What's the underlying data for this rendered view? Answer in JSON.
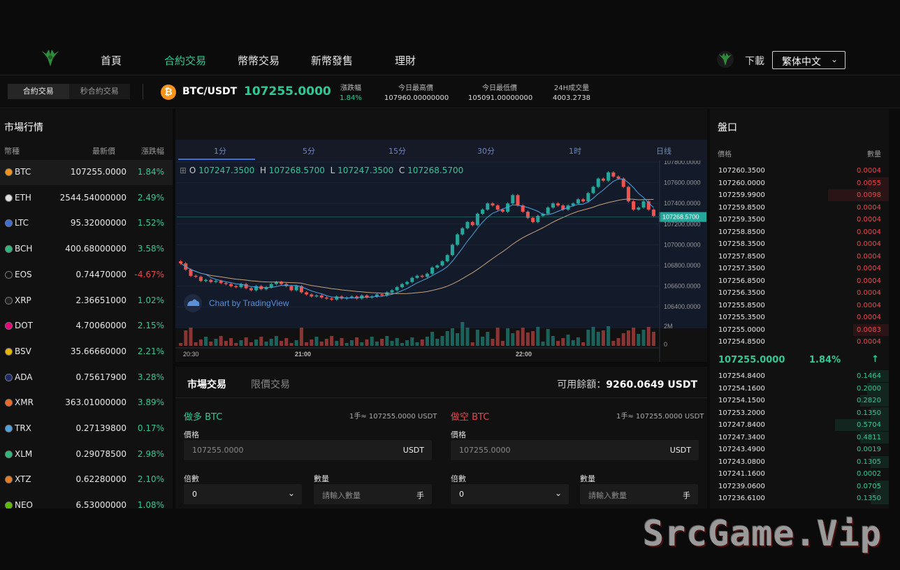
{
  "nav": {
    "items": [
      "首頁",
      "合約交易",
      "幣幣交易",
      "新幣發售",
      "理財"
    ],
    "active_index": 1,
    "download": "下載",
    "language": "繁体中文"
  },
  "ticker": {
    "modes": [
      "合約交易",
      "秒合約交易"
    ],
    "pair": "BTC/USDT",
    "price": "107255.0000",
    "stats": [
      {
        "k": "漲跌幅",
        "v": "1.84%"
      },
      {
        "k": "今日最高價",
        "v": "107960.00000000"
      },
      {
        "k": "今日最低價",
        "v": "105091.00000000"
      },
      {
        "k": "24H成交量",
        "v": "4003.2738"
      }
    ]
  },
  "market": {
    "title": "市場行情",
    "headers": [
      "幣種",
      "最新價",
      "漲跌幅"
    ],
    "rows": [
      {
        "sym": "BTC",
        "last": "107255.0000",
        "pct": "1.84%",
        "color": "#f7931a"
      },
      {
        "sym": "ETH",
        "last": "2544.54000000",
        "pct": "2.49%",
        "color": "#e0e0e0"
      },
      {
        "sym": "LTC",
        "last": "95.32000000",
        "pct": "1.52%",
        "color": "#3b6fd4"
      },
      {
        "sym": "BCH",
        "last": "400.68000000",
        "pct": "3.58%",
        "color": "#2fb67a"
      },
      {
        "sym": "EOS",
        "last": "0.74470000",
        "pct": "-4.67%",
        "color": "#111111"
      },
      {
        "sym": "XRP",
        "last": "2.36651000",
        "pct": "1.02%",
        "color": "#222222"
      },
      {
        "sym": "DOT",
        "last": "4.70060000",
        "pct": "2.15%",
        "color": "#e6007a"
      },
      {
        "sym": "BSV",
        "last": "35.66660000",
        "pct": "2.21%",
        "color": "#eab300"
      },
      {
        "sym": "ADA",
        "last": "0.75617900",
        "pct": "3.28%",
        "color": "#1c2a6a"
      },
      {
        "sym": "XMR",
        "last": "363.01000000",
        "pct": "3.89%",
        "color": "#f26822"
      },
      {
        "sym": "TRX",
        "last": "0.27139800",
        "pct": "0.17%",
        "color": "#4aa3df"
      },
      {
        "sym": "XLM",
        "last": "0.29078500",
        "pct": "2.98%",
        "color": "#2fb67a"
      },
      {
        "sym": "XTZ",
        "last": "0.62280000",
        "pct": "2.10%",
        "color": "#e97a1f"
      },
      {
        "sym": "NEO",
        "last": "6.53000000",
        "pct": "1.08%",
        "color": "#58bf00"
      }
    ]
  },
  "chart": {
    "timeframes": [
      "1分",
      "5分",
      "15分",
      "30分",
      "1时",
      "日线"
    ],
    "ohlc": {
      "o": "107247.3500",
      "h": "107268.5700",
      "l": "107247.3500",
      "c": "107268.5700"
    },
    "tv_label": "Chart by TradingView",
    "y_ticks": [
      "107800.0000",
      "107600.0000",
      "107400.0000",
      "107200.0000",
      "107000.0000",
      "106800.0000",
      "106600.0000",
      "106400.0000"
    ],
    "current_price_label": "107268.5700",
    "vol_ticks": [
      "2M",
      "0"
    ],
    "x_ticks": [
      "20:30",
      "21:00",
      "22:00"
    ],
    "colors": {
      "up": "#26a69a",
      "down": "#ef5350",
      "ma_fast": "#4aa3df",
      "ma_slow": "#c8a27a"
    }
  },
  "chart_data": {
    "type": "candlestick",
    "ylim": [
      106300,
      107800
    ],
    "closes": [
      106820,
      106760,
      106700,
      106690,
      106650,
      106660,
      106640,
      106650,
      106630,
      106620,
      106600,
      106590,
      106620,
      106580,
      106560,
      106600,
      106570,
      106590,
      106620,
      106640,
      106620,
      106600,
      106560,
      106600,
      106540,
      106520,
      106500,
      106510,
      106490,
      106480,
      106470,
      106500,
      106480,
      106490,
      106500,
      106480,
      106510,
      106490,
      106500,
      106520,
      106510,
      106540,
      106560,
      106590,
      106620,
      106640,
      106680,
      106700,
      106690,
      106720,
      106780,
      106800,
      106840,
      106900,
      107000,
      107100,
      107160,
      107220,
      107190,
      107300,
      107340,
      107400,
      107380,
      107340,
      107320,
      107400,
      107480,
      107380,
      107320,
      107260,
      107220,
      107280,
      107300,
      107360,
      107400,
      107380,
      107340,
      107380,
      107400,
      107440,
      107420,
      107500,
      107560,
      107640,
      107620,
      107700,
      107660,
      107640,
      107560,
      107420,
      107340,
      107360,
      107420,
      107340,
      107280
    ]
  },
  "trade": {
    "tabs": [
      "市場交易",
      "限價交易"
    ],
    "avail_label": "可用餘額：",
    "avail_value": "9260.0649 USDT",
    "long": {
      "title": "做多 BTC",
      "note": "1手≈ 107255.0000 USDT"
    },
    "short": {
      "title": "做空 BTC",
      "note": "1手≈ 107255.0000 USDT"
    },
    "price_label": "價格",
    "price_value": "107255.0000",
    "price_unit": "USDT",
    "mult_label": "倍數",
    "mult_value": "0",
    "qty_label": "數量",
    "qty_placeholder": "請輸入數量",
    "qty_unit": "手"
  },
  "book": {
    "title": "盤口",
    "headers": [
      "價格",
      "數量"
    ],
    "asks": [
      {
        "p": "107260.3500",
        "q": "0.0004",
        "w": 0
      },
      {
        "p": "107260.0000",
        "q": "0.0055",
        "w": 0.12
      },
      {
        "p": "107259.9900",
        "q": "0.0098",
        "w": 0.34
      },
      {
        "p": "107259.8500",
        "q": "0.0004",
        "w": 0
      },
      {
        "p": "107259.3500",
        "q": "0.0004",
        "w": 0
      },
      {
        "p": "107258.8500",
        "q": "0.0004",
        "w": 0
      },
      {
        "p": "107258.3500",
        "q": "0.0004",
        "w": 0
      },
      {
        "p": "107257.8500",
        "q": "0.0004",
        "w": 0
      },
      {
        "p": "107257.3500",
        "q": "0.0004",
        "w": 0
      },
      {
        "p": "107256.8500",
        "q": "0.0004",
        "w": 0
      },
      {
        "p": "107256.3500",
        "q": "0.0004",
        "w": 0
      },
      {
        "p": "107255.8500",
        "q": "0.0004",
        "w": 0
      },
      {
        "p": "107255.3500",
        "q": "0.0004",
        "w": 0
      },
      {
        "p": "107255.0000",
        "q": "0.0083",
        "w": 0.2
      },
      {
        "p": "107254.8500",
        "q": "0.0004",
        "w": 0
      }
    ],
    "mid_price": "107255.0000",
    "mid_pct": "1.84%",
    "mid_arrow": "↑",
    "bids": [
      {
        "p": "107254.8400",
        "q": "0.1464",
        "w": 0.1
      },
      {
        "p": "107254.1600",
        "q": "0.2000",
        "w": 0.12
      },
      {
        "p": "107254.1500",
        "q": "0.2820",
        "w": 0.16
      },
      {
        "p": "107253.2000",
        "q": "0.1350",
        "w": 0.1
      },
      {
        "p": "107247.8400",
        "q": "0.5704",
        "w": 0.3
      },
      {
        "p": "107247.3400",
        "q": "0.4811",
        "w": 0.16
      },
      {
        "p": "107243.4900",
        "q": "0.0019",
        "w": 0
      },
      {
        "p": "107243.0800",
        "q": "0.1305",
        "w": 0.1
      },
      {
        "p": "107241.1600",
        "q": "0.0002",
        "w": 0
      },
      {
        "p": "107239.0600",
        "q": "0.0705",
        "w": 0.08
      },
      {
        "p": "107236.6100",
        "q": "0.1350",
        "w": 0.1
      }
    ]
  },
  "watermark": "SrcGame.Vip"
}
